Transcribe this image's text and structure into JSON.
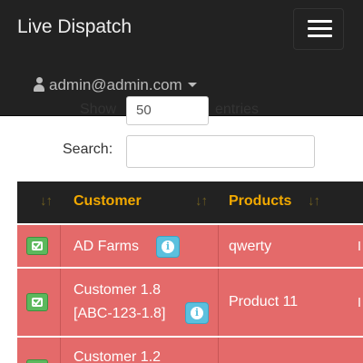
{
  "navbar": {
    "brand": "Live Dispatch",
    "user_email": "admin@admin.com"
  },
  "length_control": {
    "prefix": "Show",
    "value": "50",
    "suffix": "entries"
  },
  "search": {
    "label": "Search:",
    "value": ""
  },
  "table": {
    "headers": [
      "Customer",
      "Products"
    ],
    "rows": [
      {
        "customer": "AD Farms",
        "products": "qwerty"
      },
      {
        "customer_line1": "Customer 1.8",
        "customer_line2": "[ABC-123-1.8]",
        "products": "Product 11"
      },
      {
        "customer_line1": "Customer 1.2"
      }
    ]
  },
  "icons": {
    "menu": "hamburger-icon",
    "user": "user-icon",
    "caret": "caret-down-icon",
    "sort": "sort-icon",
    "check": "check-square-icon",
    "info": "info-icon"
  },
  "colors": {
    "navbar_bg": "#222222",
    "header_text": "#f2a900",
    "row_danger": "#e46a6a",
    "check_button": "#5cb85c",
    "info_button": "#5bc0de"
  }
}
